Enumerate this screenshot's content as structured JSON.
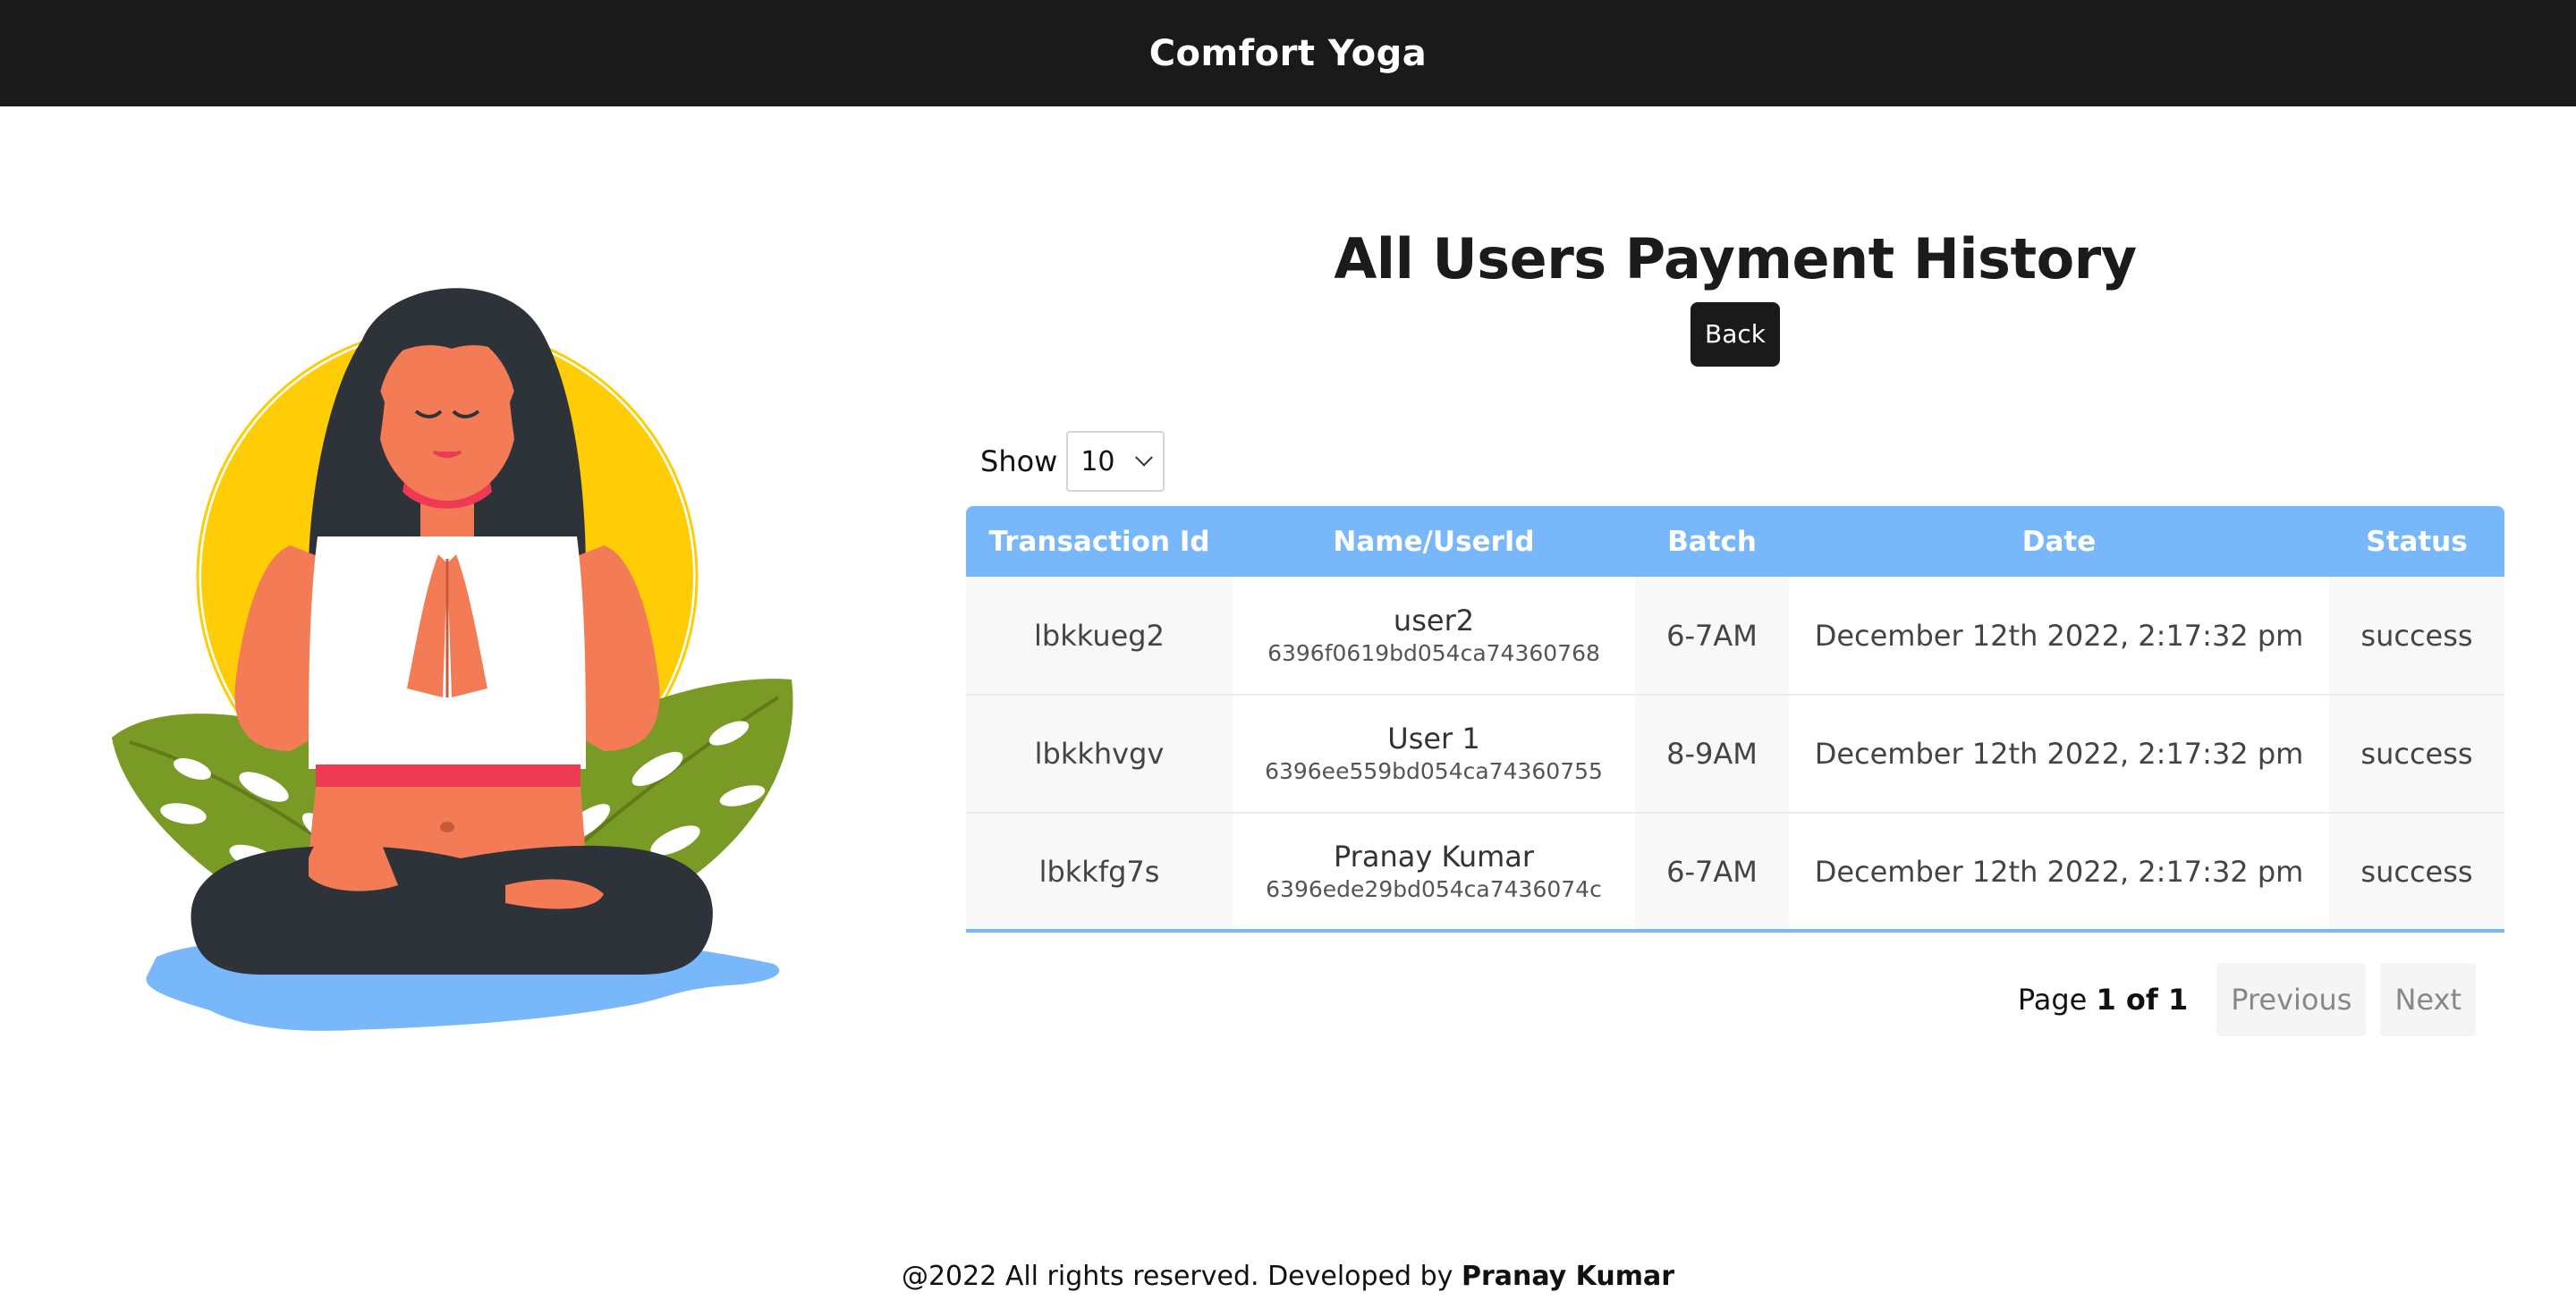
{
  "header": {
    "title": "Comfort Yoga"
  },
  "main": {
    "title": "All Users Payment History",
    "back_label": "Back",
    "show_label": "Show",
    "page_size": "10",
    "table": {
      "columns": [
        "Transaction Id",
        "Name/UserId",
        "Batch",
        "Date",
        "Status"
      ],
      "rows": [
        {
          "transaction_id": "lbkkueg2",
          "name": "user2",
          "user_id": "6396f0619bd054ca74360768",
          "batch": "6-7AM",
          "date": "December 12th 2022, 2:17:32 pm",
          "status": "success"
        },
        {
          "transaction_id": "lbkkhvgv",
          "name": "User 1",
          "user_id": "6396ee559bd054ca74360755",
          "batch": "8-9AM",
          "date": "December 12th 2022, 2:17:32 pm",
          "status": "success"
        },
        {
          "transaction_id": "lbkkfg7s",
          "name": "Pranay Kumar",
          "user_id": "6396ede29bd054ca7436074c",
          "batch": "6-7AM",
          "date": "December 12th 2022, 2:17:32 pm",
          "status": "success"
        }
      ]
    },
    "pagination": {
      "page_prefix": "Page",
      "page_value": "1 of 1",
      "previous_label": "Previous",
      "next_label": "Next"
    }
  },
  "footer": {
    "text": "@2022 All rights reserved. Developed by",
    "author": "Pranay Kumar"
  },
  "colors": {
    "header_bg": "#1a1a1a",
    "table_header_bg": "#79b7fb",
    "status_success": "#2aa04a"
  }
}
